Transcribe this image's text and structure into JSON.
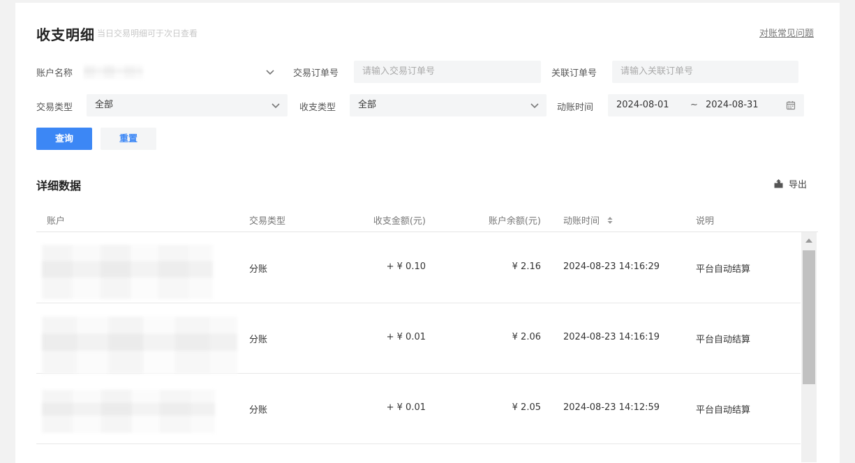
{
  "header": {
    "title": "收支明细",
    "subtitle": "当日交易明细可于次日查看",
    "faq_link": "对账常见问题"
  },
  "filters": {
    "account_name_label": "账户名称",
    "order_no_label": "交易订单号",
    "order_no_placeholder": "请输入交易订单号",
    "related_order_label": "关联订单号",
    "related_order_placeholder": "请输入关联订单号",
    "trade_type_label": "交易类型",
    "trade_type_value": "全部",
    "flow_type_label": "收支类型",
    "flow_type_value": "全部",
    "posting_time_label": "动账时间",
    "date_start": "2024-08-01",
    "date_sep": "~",
    "date_end": "2024-08-31"
  },
  "actions": {
    "query": "查询",
    "reset": "重置"
  },
  "details": {
    "title": "详细数据",
    "export": "导出"
  },
  "table": {
    "columns": {
      "account": "账户",
      "type": "交易类型",
      "amount": "收支金额(元)",
      "balance": "账户余额(元)",
      "time": "动账时间",
      "note": "说明"
    },
    "rows": [
      {
        "type": "分账",
        "amount": "+ ¥ 0.10",
        "balance": "¥ 2.16",
        "time": "2024-08-23 14:16:29",
        "note": "平台自动结算"
      },
      {
        "type": "分账",
        "amount": "+ ¥ 0.01",
        "balance": "¥ 2.06",
        "time": "2024-08-23 14:16:19",
        "note": "平台自动结算"
      },
      {
        "type": "分账",
        "amount": "+ ¥ 0.01",
        "balance": "¥ 2.05",
        "time": "2024-08-23 14:12:59",
        "note": "平台自动结算"
      }
    ]
  },
  "icons": {
    "chevron": "chevron-down-icon",
    "calendar": "calendar-icon",
    "export": "export-icon",
    "sort": "sort-icon"
  },
  "colors": {
    "primary": "#3c87f5",
    "field_bg": "#f4f5f6"
  }
}
